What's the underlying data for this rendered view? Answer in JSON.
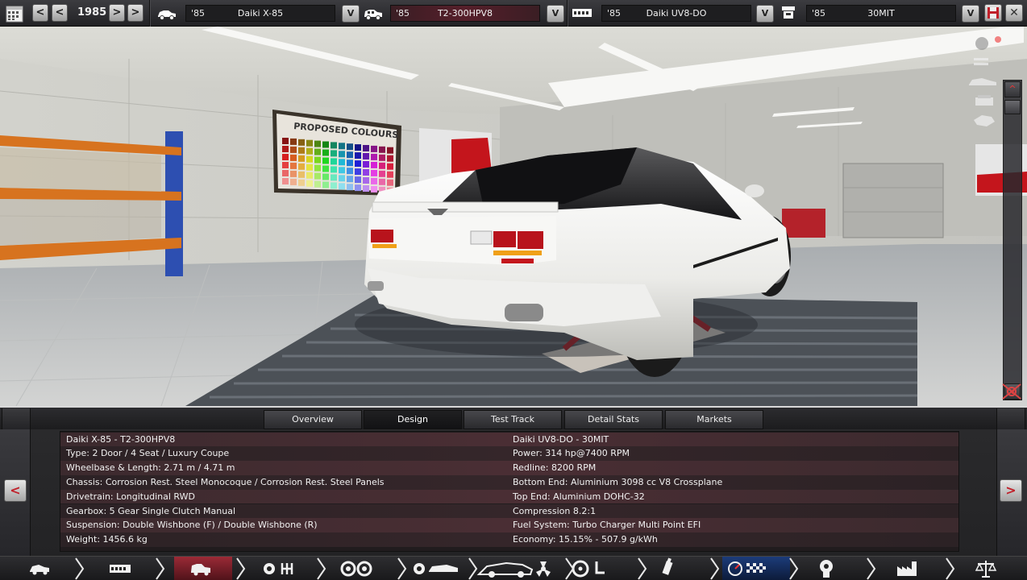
{
  "topbar": {
    "calendar_icon": "calendar-icon",
    "year": "1985",
    "slots": [
      {
        "year": "'85",
        "name": "Daiki X-85",
        "icon": "car-model-icon",
        "active": false
      },
      {
        "year": "'85",
        "name": "T2-300HPV8",
        "icon": "car-trim-icon",
        "active": true
      },
      {
        "year": "'85",
        "name": "Daiki UV8-DO",
        "icon": "engine-model-icon",
        "active": false
      },
      {
        "year": "'85",
        "name": "30MIT",
        "icon": "engine-family-icon",
        "active": false
      }
    ],
    "dropdown_glyph": "V",
    "prev_glyph": "<",
    "next_glyph": ">"
  },
  "scene": {
    "poster_title": "PROPOSED COLOURS"
  },
  "tabs": [
    {
      "label": "Overview",
      "active": false
    },
    {
      "label": "Design",
      "active": true
    },
    {
      "label": "Test Track",
      "active": false
    },
    {
      "label": "Detail Stats",
      "active": false
    },
    {
      "label": "Markets",
      "active": false
    }
  ],
  "nav_arrows": {
    "prev": "<",
    "next": ">"
  },
  "stats": {
    "left": [
      "Daiki X-85 - T2-300HPV8",
      "Type: 2 Door / 4 Seat / Luxury Coupe",
      "Wheelbase & Length: 2.71 m / 4.71 m",
      "Chassis: Corrosion Rest. Steel Monocoque / Corrosion Rest. Steel Panels",
      "Drivetrain: Longitudinal RWD",
      "Gearbox: 5 Gear Single Clutch Manual",
      "Suspension: Double Wishbone (F) / Double Wishbone (R)",
      "Weight: 1456.6 kg"
    ],
    "right": [
      "Daiki UV8-DO - 30MIT",
      "Power: 314 hp@7400 RPM",
      "Redline: 8200 RPM",
      "Bottom End: Aluminium 3098 cc V8 Crossplane",
      "Top End: Aluminium DOHC-32",
      "Compression 8.2:1",
      "Fuel System: Turbo Charger Multi Point EFI",
      "Economy: 15.15% - 507.9 g/kWh"
    ]
  },
  "bottom_nav": [
    "car-model-icon",
    "chassis-icon",
    "trim-icon",
    "drivetrain-gearbox-icon",
    "wheels-icon",
    "body-icon",
    "car-design-icon",
    "interior-icon",
    "engine-icon",
    "test-track-icon",
    "engineer-icon",
    "factory-icon",
    "balance-icon"
  ],
  "colors": {
    "accent_red": "#c0202a",
    "active_field": "#561f2a",
    "panel_bg": "#232325"
  }
}
